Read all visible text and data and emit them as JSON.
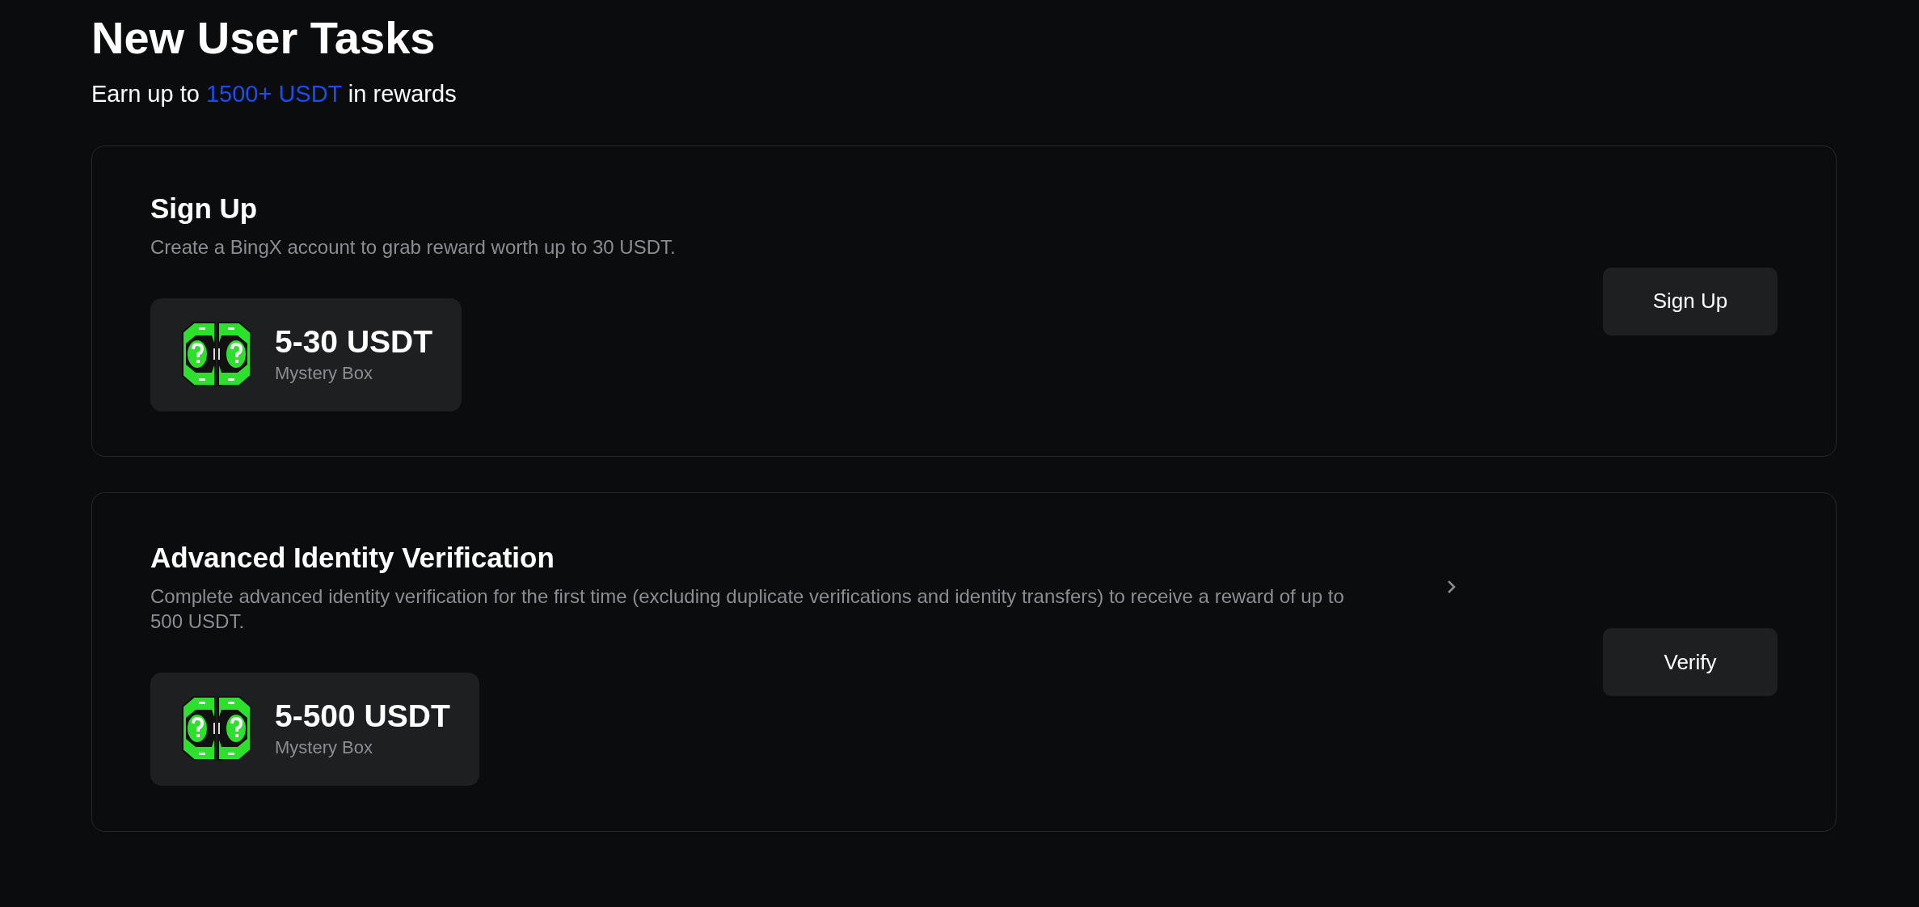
{
  "header": {
    "title": "New User Tasks",
    "subtitle": "Earn up to ",
    "highlight": "1500+ USDT",
    "subtitle_end": " in rewards"
  },
  "tasks": [
    {
      "title": "Sign Up",
      "description": "Create a BingX account to grab reward worth up to 30 USDT.",
      "has_details": false,
      "reward": {
        "amount": "5-30 USDT",
        "label": "Mystery Box"
      },
      "button": "Sign Up"
    },
    {
      "title": "Advanced Identity Verification",
      "description": "Complete advanced identity verification for the first time (excluding duplicate verifications and identity transfers) to receive a reward of up to 500 USDT.",
      "has_details": true,
      "reward": {
        "amount": "5-500 USDT",
        "label": "Mystery Box"
      },
      "button": "Verify"
    }
  ]
}
